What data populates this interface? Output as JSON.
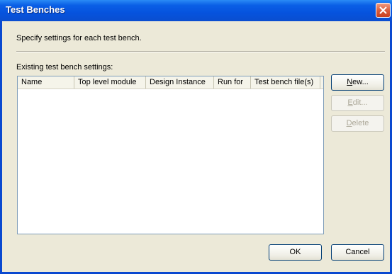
{
  "window": {
    "title": "Test Benches"
  },
  "description": "Specify settings for each test bench.",
  "list_label": "Existing test bench settings:",
  "columns": [
    "Name",
    "Top level module",
    "Design Instance",
    "Run for",
    "Test bench file(s)"
  ],
  "rows": [],
  "buttons": {
    "new": {
      "label": "New...",
      "enabled": true
    },
    "edit": {
      "label": "Edit...",
      "enabled": false
    },
    "delete": {
      "label": "Delete",
      "enabled": false
    },
    "ok": "OK",
    "cancel": "Cancel"
  },
  "colors": {
    "title_bar": "#0A5FE6",
    "dialog_bg": "#ECE9D8",
    "close_button": "#D85A38"
  }
}
